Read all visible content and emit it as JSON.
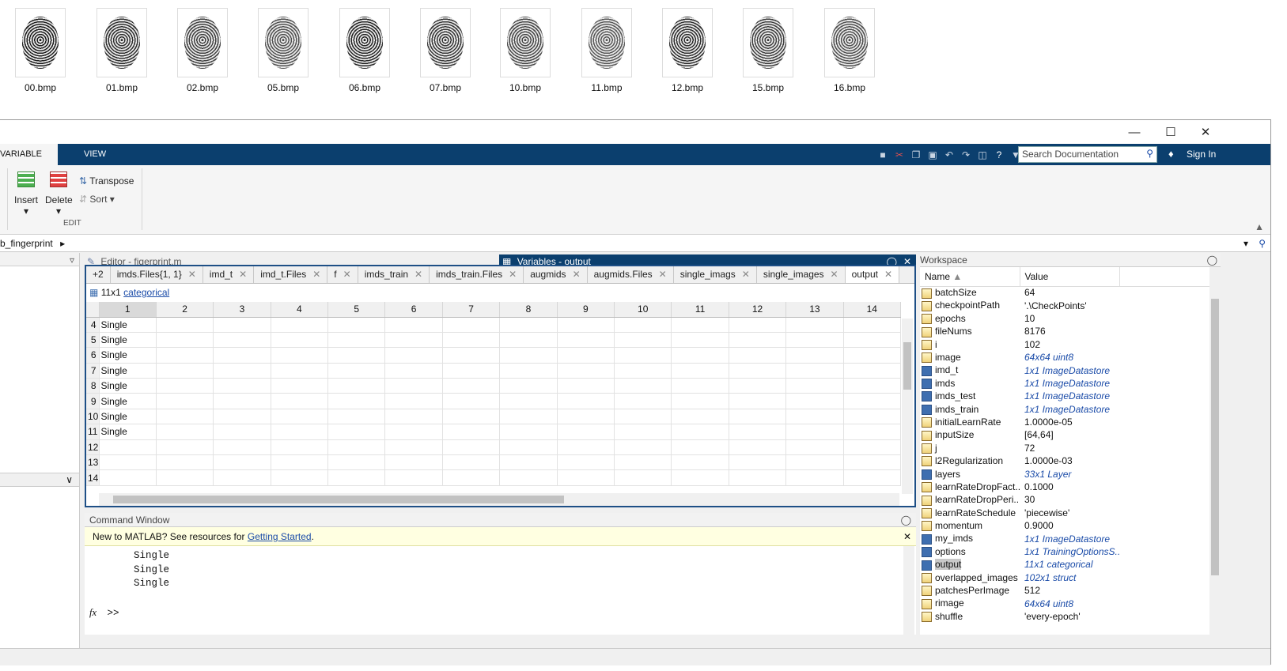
{
  "thumbnails": [
    "00.bmp",
    "01.bmp",
    "02.bmp",
    "05.bmp",
    "06.bmp",
    "07.bmp",
    "10.bmp",
    "11.bmp",
    "12.bmp",
    "15.bmp",
    "16.bmp"
  ],
  "ribbon": {
    "tab_variable": "VARIABLE",
    "tab_view": "VIEW",
    "insert": "Insert",
    "delete": "Delete",
    "transpose": "Transpose",
    "sort": "Sort",
    "section_edit": "EDIT",
    "search_placeholder": "Search Documentation",
    "sign_in": "Sign In"
  },
  "address": {
    "path": "b_fingerprint"
  },
  "editor": {
    "title": "Editor - figerprint.m"
  },
  "variables": {
    "title": "Variables - output",
    "tabs": [
      "+2",
      "imds.Files{1, 1}",
      "imd_t",
      "imd_t.Files",
      "f",
      "imds_train",
      "imds_train.Files",
      "augmids",
      "augmids.Files",
      "single_imags",
      "single_images",
      "output"
    ],
    "info_size": "11x1",
    "info_type": "categorical",
    "columns": [
      "1",
      "2",
      "3",
      "4",
      "5",
      "6",
      "7",
      "8",
      "9",
      "10",
      "11",
      "12",
      "13",
      "14"
    ],
    "rows": [
      {
        "n": "4",
        "v": "Single"
      },
      {
        "n": "5",
        "v": "Single"
      },
      {
        "n": "6",
        "v": "Single"
      },
      {
        "n": "7",
        "v": "Single"
      },
      {
        "n": "8",
        "v": "Single"
      },
      {
        "n": "9",
        "v": "Single"
      },
      {
        "n": "10",
        "v": "Single"
      },
      {
        "n": "11",
        "v": "Single"
      },
      {
        "n": "12",
        "v": ""
      },
      {
        "n": "13",
        "v": ""
      },
      {
        "n": "14",
        "v": ""
      }
    ]
  },
  "command": {
    "title": "Command Window",
    "banner_text": "New to MATLAB? See resources for ",
    "banner_link": "Getting Started",
    "banner_end": ".",
    "lines": [
      "Single",
      "Single",
      "Single"
    ],
    "prompt": ">>"
  },
  "workspace": {
    "title": "Workspace",
    "col_name": "Name",
    "col_value": "Value",
    "items": [
      {
        "name": "batchSize",
        "value": "64",
        "obj": false
      },
      {
        "name": "checkpointPath",
        "value": "'.\\CheckPoints'",
        "obj": false
      },
      {
        "name": "epochs",
        "value": "10",
        "obj": false
      },
      {
        "name": "fileNums",
        "value": "8176",
        "obj": false
      },
      {
        "name": "i",
        "value": "102",
        "obj": false
      },
      {
        "name": "image",
        "value": "64x64 uint8",
        "obj": false,
        "link": true
      },
      {
        "name": "imd_t",
        "value": "1x1 ImageDatastore",
        "obj": true,
        "link": true
      },
      {
        "name": "imds",
        "value": "1x1 ImageDatastore",
        "obj": true,
        "link": true
      },
      {
        "name": "imds_test",
        "value": "1x1 ImageDatastore",
        "obj": true,
        "link": true
      },
      {
        "name": "imds_train",
        "value": "1x1 ImageDatastore",
        "obj": true,
        "link": true
      },
      {
        "name": "initialLearnRate",
        "value": "1.0000e-05",
        "obj": false
      },
      {
        "name": "inputSize",
        "value": "[64,64]",
        "obj": false
      },
      {
        "name": "j",
        "value": "72",
        "obj": false
      },
      {
        "name": "l2Regularization",
        "value": "1.0000e-03",
        "obj": false
      },
      {
        "name": "layers",
        "value": "33x1 Layer",
        "obj": true,
        "link": true
      },
      {
        "name": "learnRateDropFact...",
        "value": "0.1000",
        "obj": false
      },
      {
        "name": "learnRateDropPeri...",
        "value": "30",
        "obj": false
      },
      {
        "name": "learnRateSchedule",
        "value": "'piecewise'",
        "obj": false
      },
      {
        "name": "momentum",
        "value": "0.9000",
        "obj": false
      },
      {
        "name": "my_imds",
        "value": "1x1 ImageDatastore",
        "obj": true,
        "link": true
      },
      {
        "name": "options",
        "value": "1x1 TrainingOptionsS...",
        "obj": true,
        "link": true
      },
      {
        "name": "output",
        "value": "11x1 categorical",
        "obj": true,
        "link": true,
        "selected": true
      },
      {
        "name": "overlapped_images",
        "value": "102x1 struct",
        "obj": false,
        "link": true
      },
      {
        "name": "patchesPerImage",
        "value": "512",
        "obj": false
      },
      {
        "name": "rimage",
        "value": "64x64 uint8",
        "obj": false,
        "link": true
      },
      {
        "name": "shuffle",
        "value": "'every-epoch'",
        "obj": false
      }
    ]
  }
}
